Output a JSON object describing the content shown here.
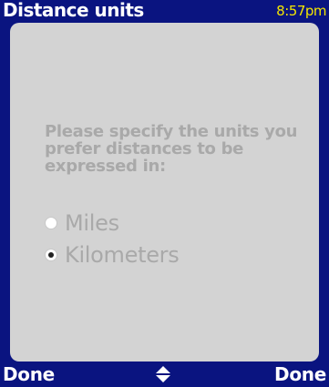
{
  "window": {
    "title": "Distance units",
    "clock": "8:57pm"
  },
  "content": {
    "prompt": "Please specify the units you prefer distances to be expressed in:",
    "options": [
      {
        "label": "Miles",
        "selected": false
      },
      {
        "label": "Kilometers",
        "selected": true
      }
    ]
  },
  "softkeys": {
    "left_label": "Done",
    "center_icon": "up-down-arrow-icon",
    "right_label": "Done"
  },
  "colors": {
    "bar_background": "#0a1480",
    "panel_background": "#d3d3d3",
    "clock_text": "#f4e600",
    "disabled_text": "#a9a9a9"
  }
}
